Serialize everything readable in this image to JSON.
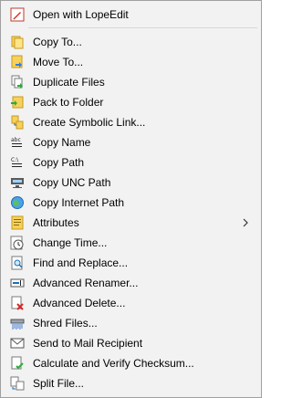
{
  "menu": {
    "items": [
      {
        "label": "Open with LopeEdit",
        "icon": "pencil-icon"
      },
      {
        "label": "Copy To...",
        "icon": "copy-to-icon"
      },
      {
        "label": "Move To...",
        "icon": "move-to-icon"
      },
      {
        "label": "Duplicate Files",
        "icon": "duplicate-icon"
      },
      {
        "label": "Pack to Folder",
        "icon": "pack-folder-icon"
      },
      {
        "label": "Create Symbolic Link...",
        "icon": "symlink-icon"
      },
      {
        "label": "Copy Name",
        "icon": "copy-name-icon"
      },
      {
        "label": "Copy Path",
        "icon": "copy-path-icon"
      },
      {
        "label": "Copy UNC Path",
        "icon": "unc-path-icon"
      },
      {
        "label": "Copy Internet Path",
        "icon": "internet-path-icon"
      },
      {
        "label": "Attributes",
        "icon": "attributes-icon",
        "submenu": true
      },
      {
        "label": "Change Time...",
        "icon": "clock-icon"
      },
      {
        "label": "Find and Replace...",
        "icon": "find-replace-icon"
      },
      {
        "label": "Advanced Renamer...",
        "icon": "renamer-icon"
      },
      {
        "label": "Advanced Delete...",
        "icon": "delete-icon"
      },
      {
        "label": "Shred Files...",
        "icon": "shredder-icon"
      },
      {
        "label": "Send to Mail Recipient",
        "icon": "mail-icon"
      },
      {
        "label": "Calculate and Verify Checksum...",
        "icon": "checksum-icon"
      },
      {
        "label": "Split File...",
        "icon": "split-file-icon"
      }
    ]
  }
}
